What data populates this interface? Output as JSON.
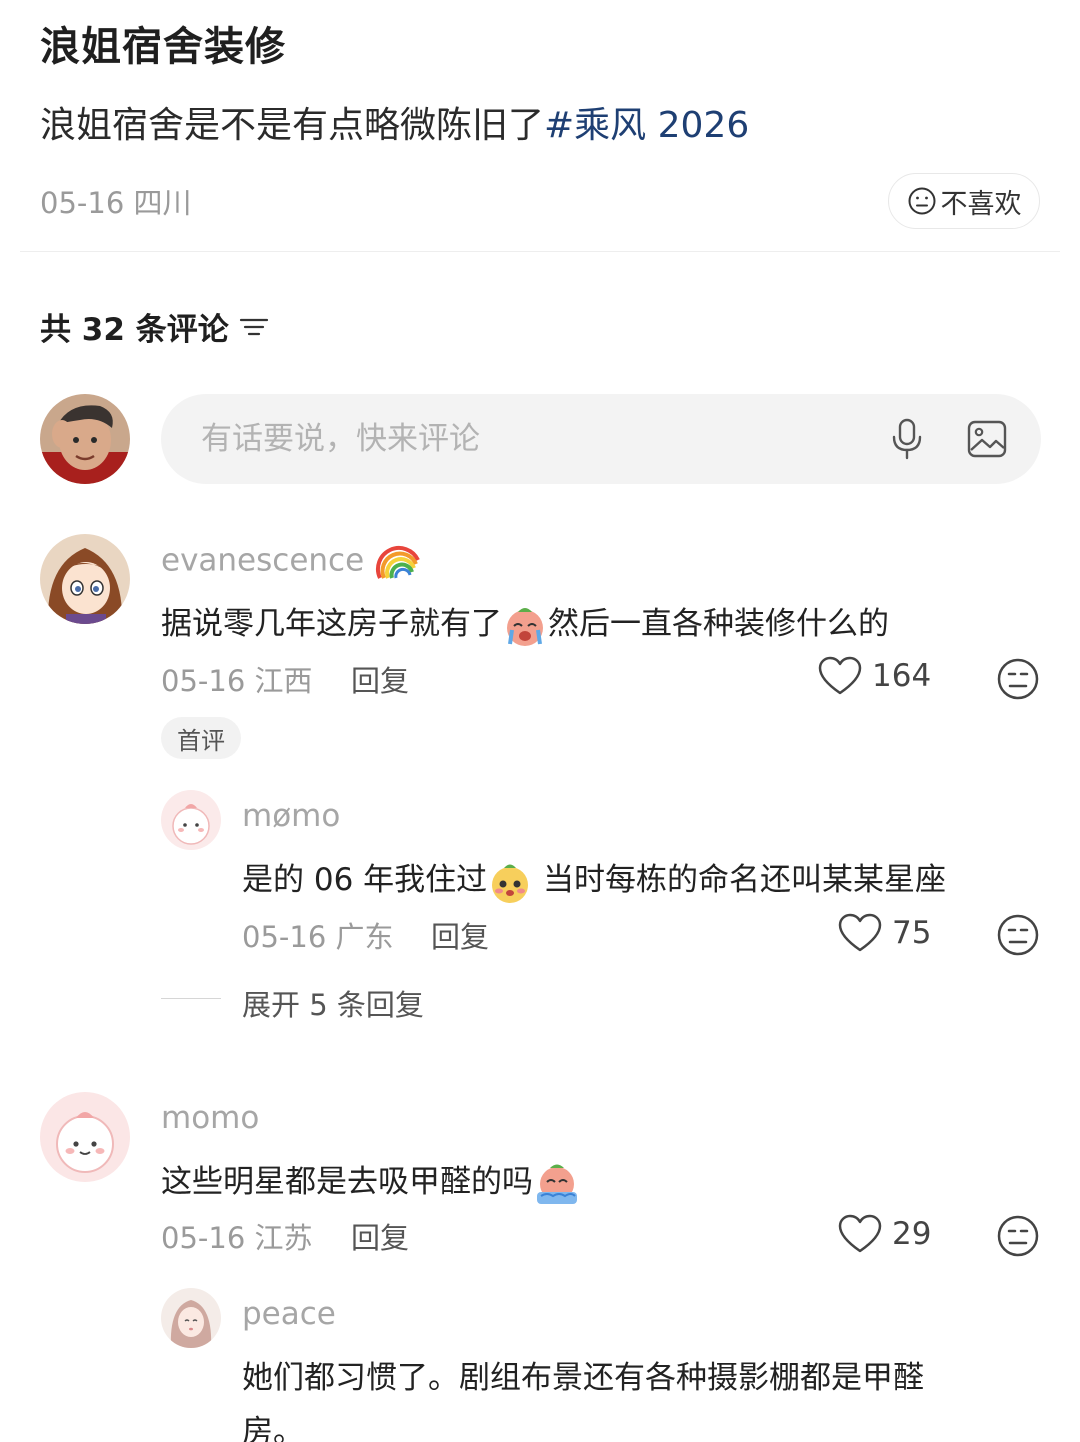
{
  "post": {
    "title": "浪姐宿舍装修",
    "body_text": "浪姐宿舍是不是有点略微陈旧了",
    "hashtag": "#乘风 2026",
    "meta": "05-16 四川",
    "dislike_label": "不喜欢"
  },
  "comments_header": {
    "count_label": "共 32 条评论"
  },
  "composer": {
    "placeholder": "有话要说，快来评论"
  },
  "comments": [
    {
      "username": "evanescence",
      "text_a": "据说零几年这房子就有了",
      "text_b": "然后一直各种装修什么的",
      "meta": "05-16 江西",
      "reply_label": "回复",
      "likes": "164",
      "badge": "首评",
      "replies": [
        {
          "username": "mømo",
          "text_a": "是的 06 年我住过",
          "text_b": " 当时每栋的命名还叫某某星座",
          "meta": "05-16 广东",
          "reply_label": "回复",
          "likes": "75"
        }
      ],
      "expand_label": "展开 5 条回复"
    },
    {
      "username": "momo",
      "text_a": "这些明星都是去吸甲醛的吗",
      "meta": "05-16 江苏",
      "reply_label": "回复",
      "likes": "29",
      "replies": [
        {
          "username": "peace",
          "text_line1": "她们都习惯了。剧组布景还有各种摄影棚都是甲醛",
          "text_line2": "房。"
        }
      ]
    }
  ],
  "colors": {
    "hashtag": "#1e3f73",
    "muted": "#9a9a9a",
    "input_bg": "#f3f3f3"
  }
}
